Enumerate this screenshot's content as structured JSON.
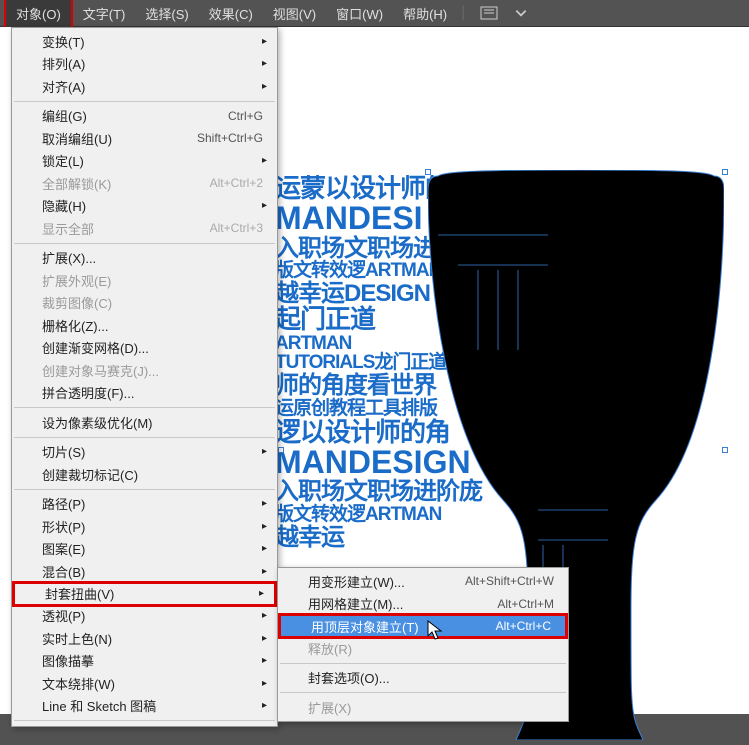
{
  "menubar": {
    "items": [
      {
        "label": "对象(O)",
        "active": true
      },
      {
        "label": "文字(T)"
      },
      {
        "label": "选择(S)"
      },
      {
        "label": "效果(C)"
      },
      {
        "label": "视图(V)"
      },
      {
        "label": "窗口(W)"
      },
      {
        "label": "帮助(H)"
      }
    ]
  },
  "object_menu": [
    {
      "label": "变换(T)",
      "submenu": true
    },
    {
      "label": "排列(A)",
      "submenu": true
    },
    {
      "label": "对齐(A)",
      "submenu": true
    },
    {
      "sep": true
    },
    {
      "label": "编组(G)",
      "shortcut": "Ctrl+G"
    },
    {
      "label": "取消编组(U)",
      "shortcut": "Shift+Ctrl+G"
    },
    {
      "label": "锁定(L)",
      "submenu": true
    },
    {
      "label": "全部解锁(K)",
      "shortcut": "Alt+Ctrl+2",
      "disabled": true
    },
    {
      "label": "隐藏(H)",
      "submenu": true
    },
    {
      "label": "显示全部",
      "shortcut": "Alt+Ctrl+3",
      "disabled": true
    },
    {
      "sep": true
    },
    {
      "label": "扩展(X)..."
    },
    {
      "label": "扩展外观(E)",
      "disabled": true
    },
    {
      "label": "裁剪图像(C)",
      "disabled": true
    },
    {
      "label": "栅格化(Z)..."
    },
    {
      "label": "创建渐变网格(D)..."
    },
    {
      "label": "创建对象马赛克(J)...",
      "disabled": true
    },
    {
      "label": "拼合透明度(F)..."
    },
    {
      "sep": true
    },
    {
      "label": "设为像素级优化(M)"
    },
    {
      "sep": true
    },
    {
      "label": "切片(S)",
      "submenu": true
    },
    {
      "label": "创建裁切标记(C)"
    },
    {
      "sep": true
    },
    {
      "label": "路径(P)",
      "submenu": true
    },
    {
      "label": "形状(P)",
      "submenu": true
    },
    {
      "label": "图案(E)",
      "submenu": true
    },
    {
      "label": "混合(B)",
      "submenu": true
    },
    {
      "label": "封套扭曲(V)",
      "submenu": true,
      "boxed": true
    },
    {
      "label": "透视(P)",
      "submenu": true
    },
    {
      "label": "实时上色(N)",
      "submenu": true
    },
    {
      "label": "图像描摹",
      "submenu": true
    },
    {
      "label": "文本绕排(W)",
      "submenu": true
    },
    {
      "label": "Line 和 Sketch 图稿",
      "submenu": true
    },
    {
      "sep": true
    }
  ],
  "envelope_submenu": [
    {
      "label": "用变形建立(W)...",
      "shortcut": "Alt+Shift+Ctrl+W"
    },
    {
      "label": "用网格建立(M)...",
      "shortcut": "Alt+Ctrl+M"
    },
    {
      "label": "用顶层对象建立(T)",
      "shortcut": "Alt+Ctrl+C",
      "highlight": true,
      "boxed2": true
    },
    {
      "label": "释放(R)",
      "disabled": true
    },
    {
      "sep": true
    },
    {
      "label": "封套选项(O)..."
    },
    {
      "sep": true
    },
    {
      "label": "扩展(X)",
      "disabled": true
    }
  ],
  "canvas_text": {
    "l1": "运蒙以设计师的角",
    "l2": "MANDESI",
    "l3": "入职场文职场进阶文",
    "l4": "版文转效逻ARTMAN",
    "l5": "越幸运DESIGN",
    "l6": "起门正道",
    "l7": "ARTMAN",
    "l8": "TUTORIALS龙门正道",
    "l9": "师的角度看世界",
    "l10": "运原创教程工具排版",
    "l11": "逻以设计师的角",
    "l12": "MANDESIGN",
    "l13": "入职场文职场进阶庞",
    "l14": "版文转效逻ARTMAN",
    "l15": "越幸运"
  }
}
